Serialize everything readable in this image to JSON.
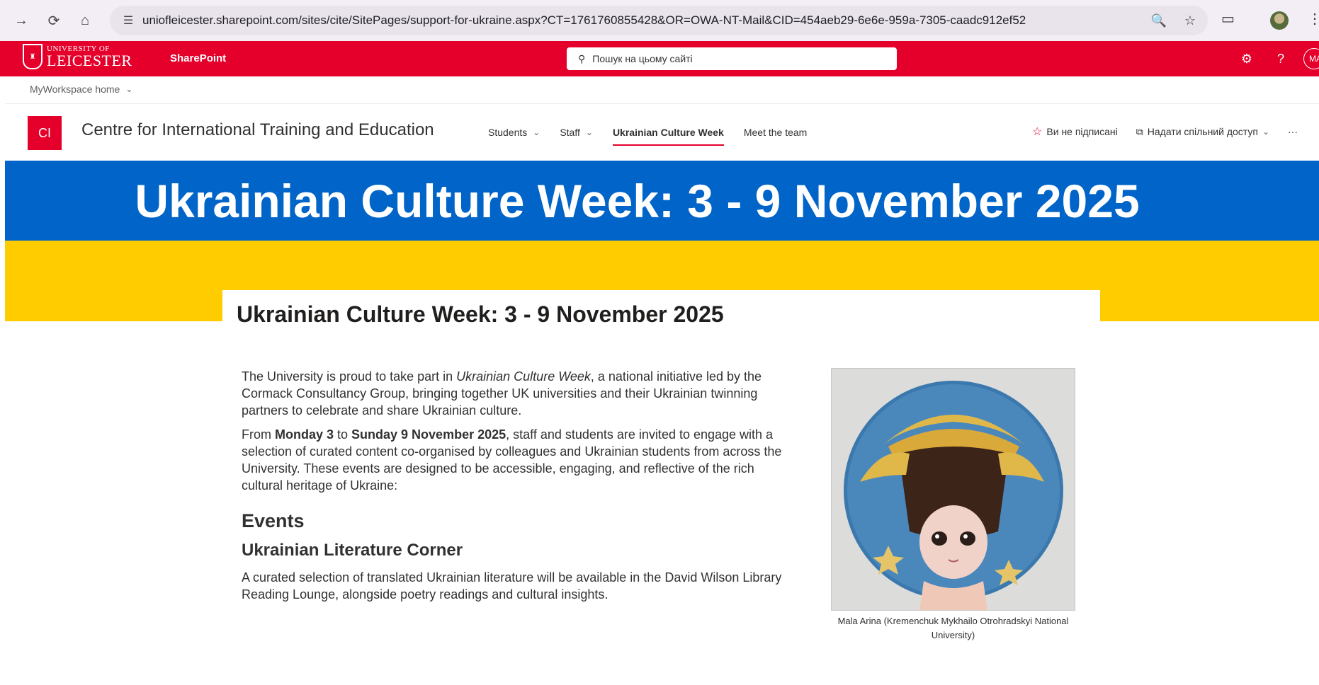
{
  "browser": {
    "url": "uniofleicester.sharepoint.com/sites/cite/SitePages/support-for-ukraine.aspx?CT=1761760855428&OR=OWA-NT-Mail&CID=454aeb29-6e6e-959a-7305-caadc912ef52"
  },
  "suite": {
    "logo_small": "UNIVERSITY OF",
    "logo_big": "LEICESTER",
    "app_name": "SharePoint",
    "search_placeholder": "Пошук на цьому сайті",
    "avatar_initials": "MA",
    "brand_color": "#e4002b"
  },
  "hub": {
    "label": "MyWorkspace home"
  },
  "site": {
    "logo_initials": "CI",
    "title": "Centre for International Training and Education",
    "nav": [
      {
        "label": "Students",
        "has_menu": true
      },
      {
        "label": "Staff",
        "has_menu": true
      },
      {
        "label": "Ukrainian Culture Week",
        "active": true
      },
      {
        "label": "Meet the team"
      }
    ],
    "follow_label": "Ви не підписані",
    "share_label": "Надати спільний доступ",
    "more_label": "···"
  },
  "banner": {
    "text": "Ukrainian Culture Week: 3 - 9 November 2025",
    "colors": {
      "blue": "#0064c8",
      "yellow": "#ffcc00"
    }
  },
  "page": {
    "title": "Ukrainian Culture Week: 3 - 9 November 2025",
    "intro_pre": "The University is proud to take part in ",
    "intro_em": "Ukrainian Culture Week",
    "intro_post": ", a national initiative led by the Cormack Consultancy Group, bringing together UK universities and their Ukrainian twinning partners to celebrate and share Ukrainian culture.",
    "p2_a": "From ",
    "p2_b": "Monday 3",
    "p2_c": " to ",
    "p2_d": "Sunday 9 November 2025",
    "p2_e": ", staff and students are invited to engage with a selection of curated content co-organised by colleagues and Ukrainian students from across the University. These events are designed to be accessible, engaging, and reflective of the rich cultural heritage of Ukraine:",
    "events_heading": "Events",
    "subheading": "Ukrainian Literature Corner",
    "literature_text": "A curated selection of translated Ukrainian literature will be available in the David Wilson Library Reading Lounge, alongside poetry readings and cultural insights.",
    "image_caption": "Mala Arina (Kremenchuk Mykhailo Otrohradskyi National University)"
  }
}
